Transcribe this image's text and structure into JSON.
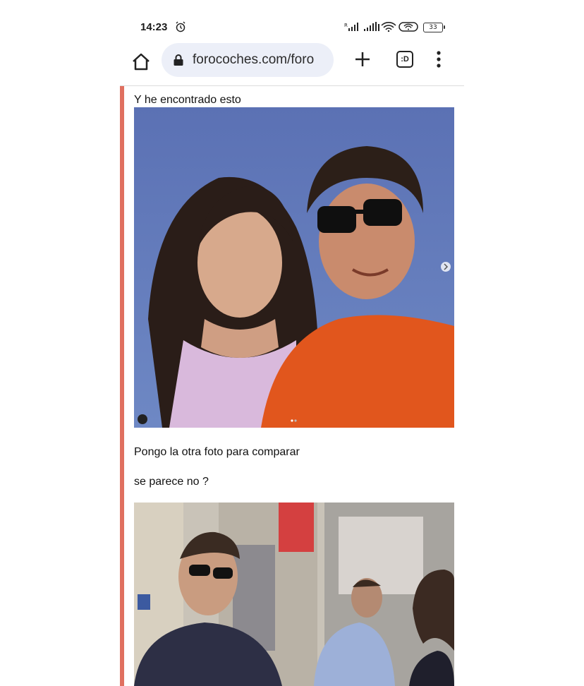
{
  "status_bar": {
    "time": "14:23",
    "battery": "33",
    "icons": [
      "alarm-icon",
      "signal-icon",
      "signal-icon",
      "wifi-icon",
      "hotspot-icon",
      "battery-icon"
    ]
  },
  "browser": {
    "url": "forocoches.com/foro",
    "tabs_label": ":D",
    "icons": [
      "home-icon",
      "lock-icon",
      "plus-icon",
      "tabs-icon",
      "more-vert-icon"
    ]
  },
  "post": {
    "line1": "Y he encontrado esto",
    "line2": "Pongo la otra foto para comparar",
    "line3": "se parece no ?"
  },
  "colors": {
    "quote_bar": "#e07060",
    "omnibox": "#eceff8"
  }
}
